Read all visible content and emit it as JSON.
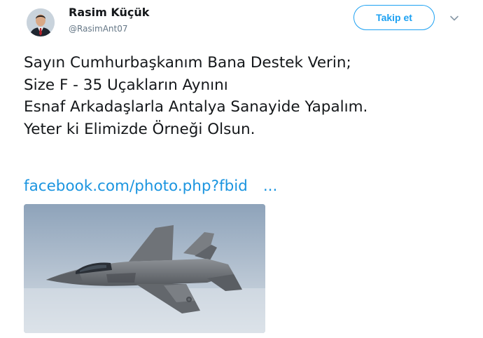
{
  "author": {
    "display_name": "Rasim Küçük",
    "handle": "@RasimAnt07"
  },
  "follow_button": {
    "label": "Takip et"
  },
  "tweet": {
    "lines": [
      "Sayın Cumhurbaşkanım Bana Destek Verin;",
      "Size F - 35 Uçakların Aynını",
      "Esnaf Arkadaşlarla Antalya Sanayide Yapalım.",
      "Yeter ki Elimizde Örneği Olsun."
    ],
    "link_text": "facebook.com/photo.php?fbid",
    "link_ellipsis": "..."
  },
  "media": {
    "subject": "F-35 fighter jet in flight"
  },
  "icons": {
    "avatar": "avatar-photo",
    "caret": "chevron-down-icon"
  },
  "colors": {
    "accent": "#1da1f2",
    "link": "#1b95e0",
    "text": "#14171a",
    "secondary_text": "#657786"
  }
}
